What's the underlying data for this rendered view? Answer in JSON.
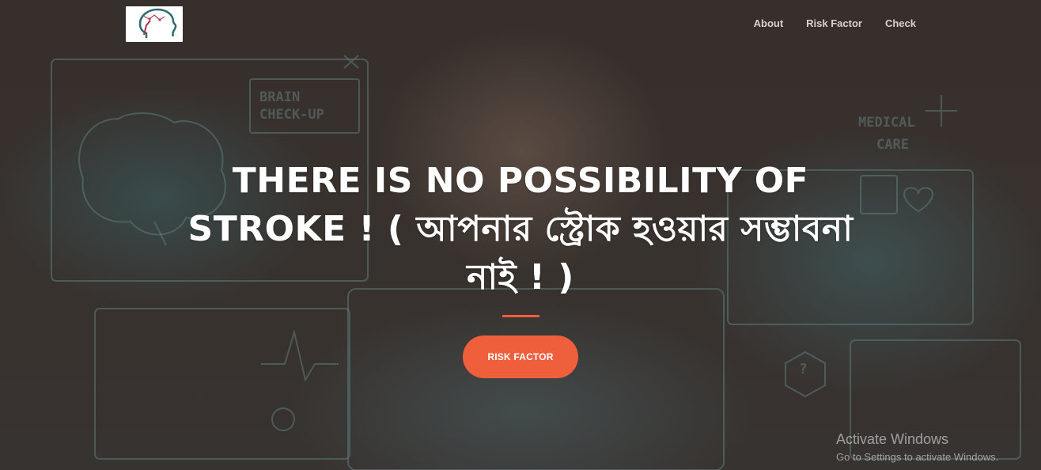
{
  "nav": {
    "links": [
      {
        "label": "About"
      },
      {
        "label": "Risk Factor"
      },
      {
        "label": "Check"
      }
    ]
  },
  "background": {
    "panel_text": {
      "brain_checkup": "BRAIN\nCHECK-UP",
      "medical_care": "MEDICAL\nCARE"
    }
  },
  "hero": {
    "headline": "THERE IS NO POSSIBILITY OF STROKE ! ( আপনার স্ট্রোক হওয়ার সম্ভাবনা নাই ! )",
    "cta_label": "RISK FACTOR"
  },
  "watermark": {
    "title": "Activate Windows",
    "subtitle": "Go to Settings to activate Windows."
  },
  "colors": {
    "accent": "#f05f3b",
    "nav_text": "#d9d2cc",
    "headline": "#ffffff"
  }
}
